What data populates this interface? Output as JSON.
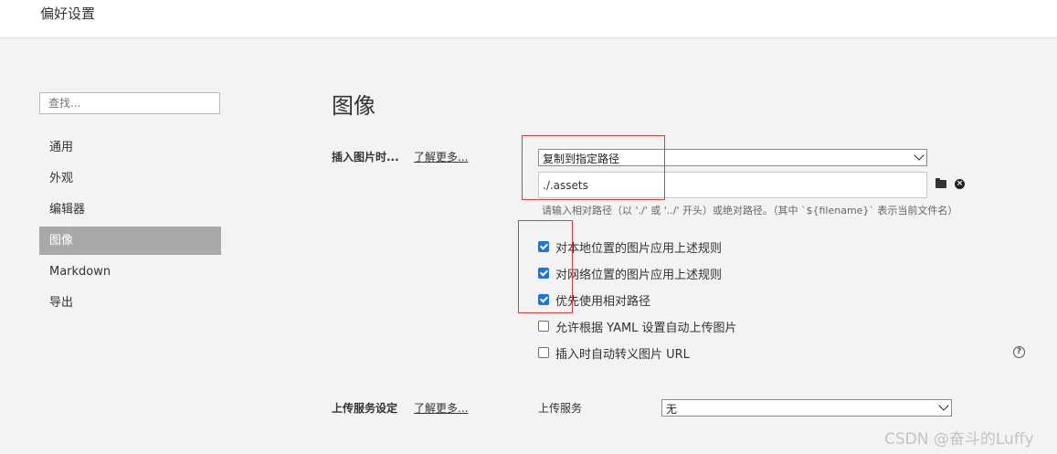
{
  "window": {
    "title": "偏好设置"
  },
  "sidebar": {
    "search_placeholder": "查找...",
    "items": [
      {
        "label": "通用",
        "active": false
      },
      {
        "label": "外观",
        "active": false
      },
      {
        "label": "编辑器",
        "active": false
      },
      {
        "label": "图像",
        "active": true
      },
      {
        "label": "Markdown",
        "active": false
      },
      {
        "label": "导出",
        "active": false
      }
    ]
  },
  "main": {
    "title": "图像",
    "insert_image": {
      "label": "插入图片时...",
      "learn_more": "了解更多...",
      "action_selected": "复制到指定路径",
      "path_value": "./.assets",
      "hint": "请输入相对路径（以 './' 或 '../' 开头）或绝对路径。（其中 `${filename}` 表示当前文件名）"
    },
    "options": [
      {
        "label": "对本地位置的图片应用上述规则",
        "checked": true
      },
      {
        "label": "对网络位置的图片应用上述规则",
        "checked": true
      },
      {
        "label": "优先使用相对路径",
        "checked": true
      },
      {
        "label": "允许根据 YAML 设置自动上传图片",
        "checked": false
      },
      {
        "label": "插入时自动转义图片 URL",
        "checked": false
      }
    ],
    "upload": {
      "label": "上传服务设定",
      "learn_more": "了解更多...",
      "service_label": "上传服务",
      "service_selected": "无"
    }
  },
  "icons": {
    "folder": "folder-icon",
    "clear": "clear-icon",
    "help": "help-icon"
  },
  "watermark": "CSDN @奋斗的Luffy"
}
